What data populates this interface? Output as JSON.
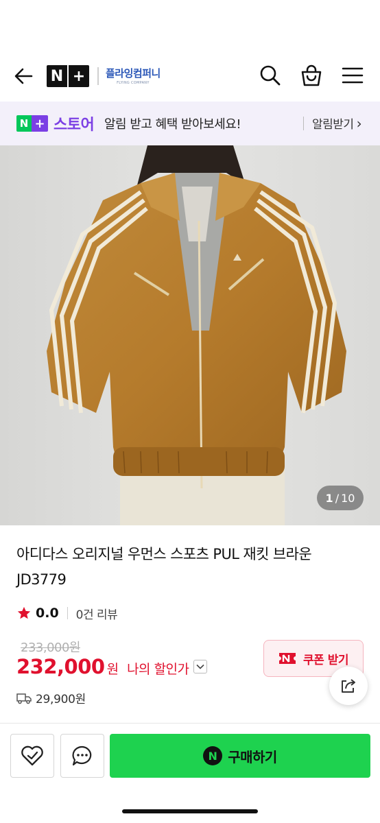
{
  "header": {
    "logo_n": "N",
    "logo_plus": "+",
    "store_name": "플라잉컴퍼니",
    "store_name_en": "FLYING COMPANY"
  },
  "notice": {
    "badge_n": "N",
    "badge_plus": "+",
    "store_word": "스토어",
    "message": "알림 받고 혜택 받아보세요!",
    "subscribe_label": "알림받기",
    "subscribe_chevron": "›"
  },
  "gallery": {
    "current": "1",
    "separator": "/",
    "total": "10"
  },
  "product": {
    "title": "아디다스 오리지널 우먼스 스포츠 PUL 재킷 브라운 JD3779",
    "rating": "0.0",
    "review_count": "0건 리뷰",
    "original_price": "233,000원",
    "price": "232,000",
    "price_unit": "원",
    "discount_label": "나의 할인가",
    "coupon_label": "쿠폰 받기",
    "shipping_fee": "29,900원"
  },
  "bottom_bar": {
    "buy_label": "구매하기",
    "buy_badge": "N"
  },
  "colors": {
    "naver_green": "#03c75a",
    "buy_green": "#1ed24f",
    "plus_purple": "#7b3fe4",
    "price_red": "#e0112e",
    "notice_bg": "#f3f0fa"
  }
}
